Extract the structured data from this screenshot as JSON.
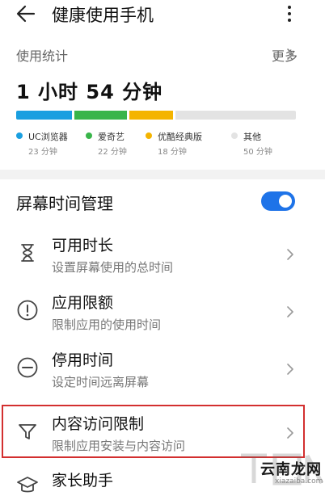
{
  "header": {
    "title": "健康使用手机",
    "back_icon": "arrow-left-icon",
    "menu_icon": "more-vertical-icon"
  },
  "stats": {
    "label": "使用统计",
    "more_label": "更多",
    "total_time": "1 小时 54 分钟"
  },
  "usage": {
    "apps": [
      {
        "name": "UC浏览器",
        "time": "23 分钟",
        "minutes": 23,
        "color": "#1a9fe0"
      },
      {
        "name": "爱奇艺",
        "time": "22 分钟",
        "minutes": 22,
        "color": "#39b54a"
      },
      {
        "name": "优酷经典版",
        "time": "18 分钟",
        "minutes": 18,
        "color": "#f4b400"
      },
      {
        "name": "其他",
        "time": "50 分钟",
        "minutes": 50,
        "color": "#e3e3e3"
      }
    ]
  },
  "screen_time": {
    "label": "屏幕时间管理",
    "enabled": true,
    "accent": "#1e73e8"
  },
  "items": [
    {
      "title": "可用时长",
      "subtitle": "设置屏幕使用的总时间",
      "icon": "hourglass-icon"
    },
    {
      "title": "应用限额",
      "subtitle": "限制应用的使用时间",
      "icon": "exclamation-circle-icon"
    },
    {
      "title": "停用时间",
      "subtitle": "设定时间远离屏幕",
      "icon": "minus-circle-icon"
    },
    {
      "title": "内容访问限制",
      "subtitle": "限制应用安装与内容访问",
      "icon": "funnel-icon"
    },
    {
      "title": "家长助手",
      "subtitle": "",
      "icon": "graduation-cap-icon"
    }
  ],
  "watermark": {
    "text": "云南龙网",
    "url": "xiazaiba.com"
  }
}
